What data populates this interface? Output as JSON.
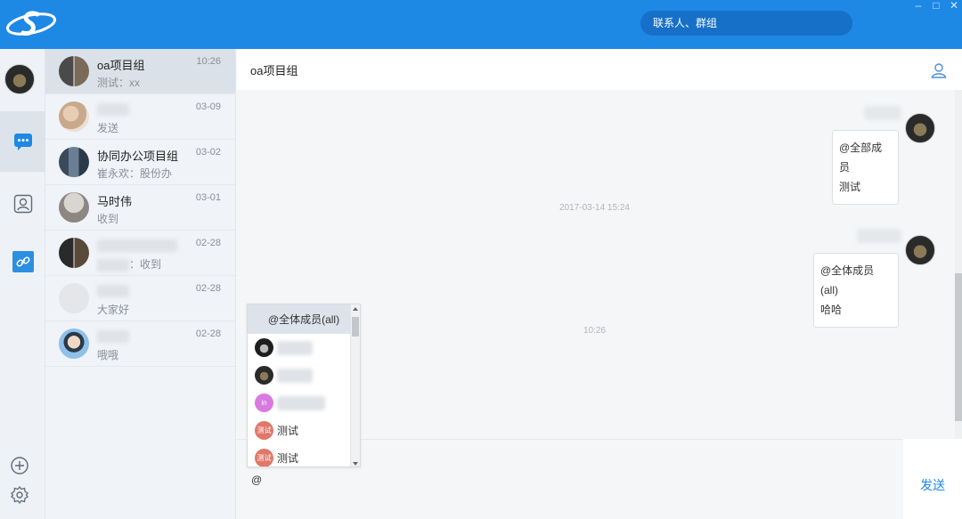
{
  "titlebar": {
    "search_label": "联系人、群组",
    "accent_color": "#1e88e5"
  },
  "conversations": [
    {
      "name": "oa项目组",
      "preview": "测试：xx",
      "time": "10:26"
    },
    {
      "name": "",
      "preview": "发送",
      "time": "03-09"
    },
    {
      "name": "协同办公项目组",
      "preview": "崔永欢：股份办",
      "time": "03-02"
    },
    {
      "name": "马时伟",
      "preview": "收到",
      "time": "03-01"
    },
    {
      "name": "",
      "preview": "：收到",
      "time": "02-28"
    },
    {
      "name": "",
      "preview": "大家好",
      "time": "02-28"
    },
    {
      "name": "",
      "preview": "哦哦",
      "time": "02-28"
    }
  ],
  "chat": {
    "title": "oa项目组",
    "messages": [
      {
        "line1": "@全部成员",
        "line2": "测试"
      },
      {
        "timestamp": "2017-03-14 15:24"
      },
      {
        "line1": "@全体成员(all)",
        "line2": "哈哈"
      },
      {
        "timestamp": "10:26"
      }
    ],
    "input_value": "@",
    "send_label": "发送"
  },
  "mention_popup": {
    "items": [
      {
        "label": "@全体成员(all)"
      },
      {
        "label": ""
      },
      {
        "label": ""
      },
      {
        "label": "",
        "avatar_text": "in"
      },
      {
        "label": "测试",
        "avatar_text": "测试"
      },
      {
        "label": "测试",
        "avatar_text": "测试"
      }
    ]
  }
}
